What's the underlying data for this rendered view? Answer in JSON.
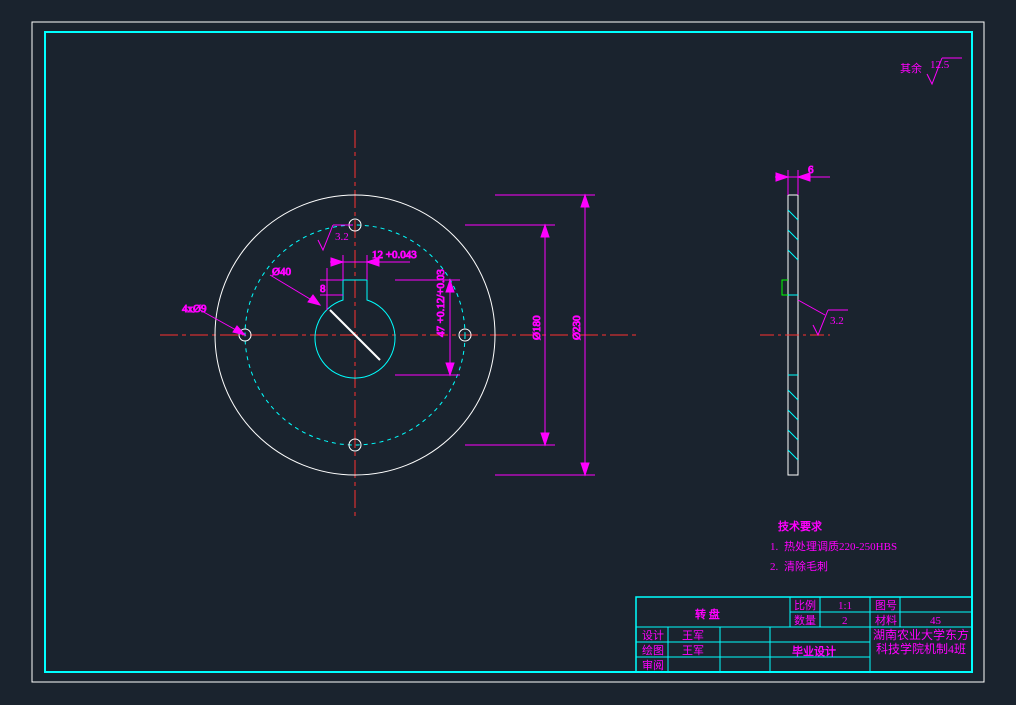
{
  "surface_note": {
    "label": "其余",
    "value": "12.5"
  },
  "dims": {
    "outer_dia": "Ø230",
    "pcd": "Ø180",
    "bore_tol": "47 +0.12/+0.03",
    "key_width": "12 +0.043",
    "key_height": "8",
    "bore_dia": "Ø40",
    "holes": "4xØ9",
    "thickness": "6",
    "side_finish": "3.2",
    "top_finish": "3.2"
  },
  "tech": {
    "title": "技术要求",
    "line1_no": "1.",
    "line1_txt": "热处理调质220-250HBS",
    "line2_no": "2.",
    "line2_txt": "清除毛刺"
  },
  "title_block": {
    "part_name": "转 盘",
    "scale_label": "比例",
    "scale_value": "1:1",
    "drawing_no_label": "图号",
    "drawing_no_value": "",
    "qty_label": "数量",
    "qty_value": "2",
    "material_label": "材料",
    "material_value": "45",
    "design_label": "设计",
    "design_name": "王军",
    "drawn_label": "绘图",
    "drawn_name": "王军",
    "check_label": "审阅",
    "check_name": "",
    "project": "毕业设计",
    "school": "湖南农业大学东方科技学院机制4班"
  }
}
